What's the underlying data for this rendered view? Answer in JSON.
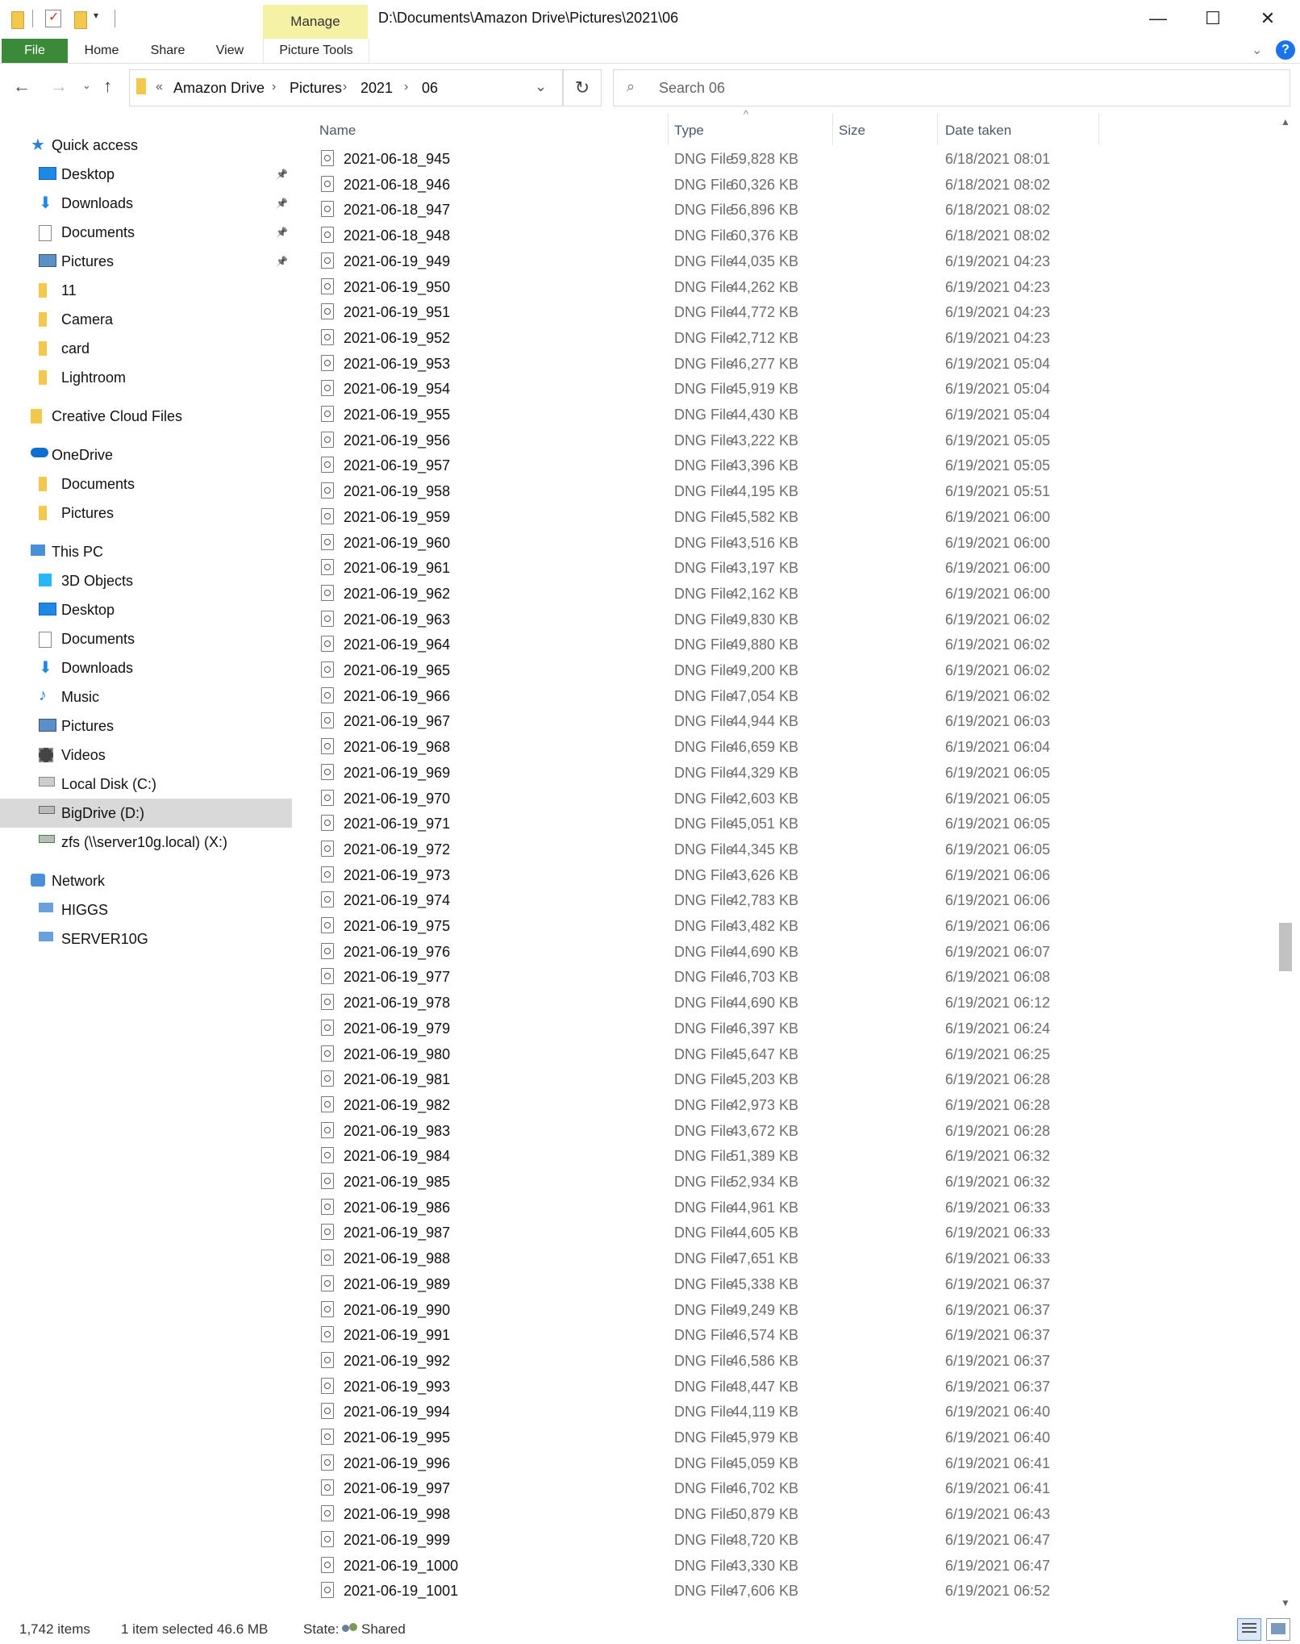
{
  "window": {
    "title_path": "D:\\Documents\\Amazon Drive\\Pictures\\2021\\06",
    "contextual_tab": "Manage",
    "controls": {
      "minimize": "—",
      "maximize": "☐",
      "close": "✕"
    }
  },
  "ribbon": {
    "tabs": [
      "File",
      "Home",
      "Share",
      "View",
      "Picture Tools"
    ],
    "help": "?"
  },
  "address": {
    "overflow": "«",
    "crumbs": [
      "Amazon Drive",
      "Pictures",
      "2021",
      "06"
    ],
    "search_placeholder": "Search 06"
  },
  "nav": {
    "quick_access": "Quick access",
    "qa_items": [
      "Desktop",
      "Downloads",
      "Documents",
      "Pictures",
      "11",
      "Camera",
      "card",
      "Lightroom"
    ],
    "creative_cloud": "Creative Cloud Files",
    "onedrive": "OneDrive",
    "onedrive_items": [
      "Documents",
      "Pictures"
    ],
    "this_pc": "This PC",
    "pc_items": [
      "3D Objects",
      "Desktop",
      "Documents",
      "Downloads",
      "Music",
      "Pictures",
      "Videos",
      "Local Disk (C:)",
      "BigDrive (D:)",
      "zfs (\\\\server10g.local) (X:)"
    ],
    "network": "Network",
    "network_items": [
      "HIGGS",
      "SERVER10G"
    ]
  },
  "columns": {
    "name": "Name",
    "type": "Type",
    "size": "Size",
    "date": "Date taken"
  },
  "files": [
    [
      "2021-06-18_945",
      "DNG File",
      "59,828 KB",
      "6/18/2021 08:01"
    ],
    [
      "2021-06-18_946",
      "DNG File",
      "60,326 KB",
      "6/18/2021 08:02"
    ],
    [
      "2021-06-18_947",
      "DNG File",
      "56,896 KB",
      "6/18/2021 08:02"
    ],
    [
      "2021-06-18_948",
      "DNG File",
      "60,376 KB",
      "6/18/2021 08:02"
    ],
    [
      "2021-06-19_949",
      "DNG File",
      "44,035 KB",
      "6/19/2021 04:23"
    ],
    [
      "2021-06-19_950",
      "DNG File",
      "44,262 KB",
      "6/19/2021 04:23"
    ],
    [
      "2021-06-19_951",
      "DNG File",
      "44,772 KB",
      "6/19/2021 04:23"
    ],
    [
      "2021-06-19_952",
      "DNG File",
      "42,712 KB",
      "6/19/2021 04:23"
    ],
    [
      "2021-06-19_953",
      "DNG File",
      "46,277 KB",
      "6/19/2021 05:04"
    ],
    [
      "2021-06-19_954",
      "DNG File",
      "45,919 KB",
      "6/19/2021 05:04"
    ],
    [
      "2021-06-19_955",
      "DNG File",
      "44,430 KB",
      "6/19/2021 05:04"
    ],
    [
      "2021-06-19_956",
      "DNG File",
      "43,222 KB",
      "6/19/2021 05:05"
    ],
    [
      "2021-06-19_957",
      "DNG File",
      "43,396 KB",
      "6/19/2021 05:05"
    ],
    [
      "2021-06-19_958",
      "DNG File",
      "44,195 KB",
      "6/19/2021 05:51"
    ],
    [
      "2021-06-19_959",
      "DNG File",
      "45,582 KB",
      "6/19/2021 06:00"
    ],
    [
      "2021-06-19_960",
      "DNG File",
      "43,516 KB",
      "6/19/2021 06:00"
    ],
    [
      "2021-06-19_961",
      "DNG File",
      "43,197 KB",
      "6/19/2021 06:00"
    ],
    [
      "2021-06-19_962",
      "DNG File",
      "42,162 KB",
      "6/19/2021 06:00"
    ],
    [
      "2021-06-19_963",
      "DNG File",
      "49,830 KB",
      "6/19/2021 06:02"
    ],
    [
      "2021-06-19_964",
      "DNG File",
      "49,880 KB",
      "6/19/2021 06:02"
    ],
    [
      "2021-06-19_965",
      "DNG File",
      "49,200 KB",
      "6/19/2021 06:02"
    ],
    [
      "2021-06-19_966",
      "DNG File",
      "47,054 KB",
      "6/19/2021 06:02"
    ],
    [
      "2021-06-19_967",
      "DNG File",
      "44,944 KB",
      "6/19/2021 06:03"
    ],
    [
      "2021-06-19_968",
      "DNG File",
      "46,659 KB",
      "6/19/2021 06:04"
    ],
    [
      "2021-06-19_969",
      "DNG File",
      "44,329 KB",
      "6/19/2021 06:05"
    ],
    [
      "2021-06-19_970",
      "DNG File",
      "42,603 KB",
      "6/19/2021 06:05"
    ],
    [
      "2021-06-19_971",
      "DNG File",
      "45,051 KB",
      "6/19/2021 06:05"
    ],
    [
      "2021-06-19_972",
      "DNG File",
      "44,345 KB",
      "6/19/2021 06:05"
    ],
    [
      "2021-06-19_973",
      "DNG File",
      "43,626 KB",
      "6/19/2021 06:06"
    ],
    [
      "2021-06-19_974",
      "DNG File",
      "42,783 KB",
      "6/19/2021 06:06"
    ],
    [
      "2021-06-19_975",
      "DNG File",
      "43,482 KB",
      "6/19/2021 06:06"
    ],
    [
      "2021-06-19_976",
      "DNG File",
      "44,690 KB",
      "6/19/2021 06:07"
    ],
    [
      "2021-06-19_977",
      "DNG File",
      "46,703 KB",
      "6/19/2021 06:08"
    ],
    [
      "2021-06-19_978",
      "DNG File",
      "44,690 KB",
      "6/19/2021 06:12"
    ],
    [
      "2021-06-19_979",
      "DNG File",
      "46,397 KB",
      "6/19/2021 06:24"
    ],
    [
      "2021-06-19_980",
      "DNG File",
      "45,647 KB",
      "6/19/2021 06:25"
    ],
    [
      "2021-06-19_981",
      "DNG File",
      "45,203 KB",
      "6/19/2021 06:28"
    ],
    [
      "2021-06-19_982",
      "DNG File",
      "42,973 KB",
      "6/19/2021 06:28"
    ],
    [
      "2021-06-19_983",
      "DNG File",
      "43,672 KB",
      "6/19/2021 06:28"
    ],
    [
      "2021-06-19_984",
      "DNG File",
      "51,389 KB",
      "6/19/2021 06:32"
    ],
    [
      "2021-06-19_985",
      "DNG File",
      "52,934 KB",
      "6/19/2021 06:32"
    ],
    [
      "2021-06-19_986",
      "DNG File",
      "44,961 KB",
      "6/19/2021 06:33"
    ],
    [
      "2021-06-19_987",
      "DNG File",
      "44,605 KB",
      "6/19/2021 06:33"
    ],
    [
      "2021-06-19_988",
      "DNG File",
      "47,651 KB",
      "6/19/2021 06:33"
    ],
    [
      "2021-06-19_989",
      "DNG File",
      "45,338 KB",
      "6/19/2021 06:37"
    ],
    [
      "2021-06-19_990",
      "DNG File",
      "49,249 KB",
      "6/19/2021 06:37"
    ],
    [
      "2021-06-19_991",
      "DNG File",
      "46,574 KB",
      "6/19/2021 06:37"
    ],
    [
      "2021-06-19_992",
      "DNG File",
      "46,586 KB",
      "6/19/2021 06:37"
    ],
    [
      "2021-06-19_993",
      "DNG File",
      "48,447 KB",
      "6/19/2021 06:37"
    ],
    [
      "2021-06-19_994",
      "DNG File",
      "44,119 KB",
      "6/19/2021 06:40"
    ],
    [
      "2021-06-19_995",
      "DNG File",
      "45,979 KB",
      "6/19/2021 06:40"
    ],
    [
      "2021-06-19_996",
      "DNG File",
      "45,059 KB",
      "6/19/2021 06:41"
    ],
    [
      "2021-06-19_997",
      "DNG File",
      "46,702 KB",
      "6/19/2021 06:41"
    ],
    [
      "2021-06-19_998",
      "DNG File",
      "50,879 KB",
      "6/19/2021 06:43"
    ],
    [
      "2021-06-19_999",
      "DNG File",
      "48,720 KB",
      "6/19/2021 06:47"
    ],
    [
      "2021-06-19_1000",
      "DNG File",
      "43,330 KB",
      "6/19/2021 06:47"
    ],
    [
      "2021-06-19_1001",
      "DNG File",
      "47,606 KB",
      "6/19/2021 06:52"
    ]
  ],
  "status": {
    "items": "1,742 items",
    "selection": "1 item selected  46.6 MB",
    "state_label": "State:",
    "state_value": "Shared"
  },
  "colors": {
    "file_tab": "#3a8a3a",
    "manage_tab": "#f5f1a5",
    "selected_nav": "#d9d9d9",
    "help": "#1a73e8"
  }
}
